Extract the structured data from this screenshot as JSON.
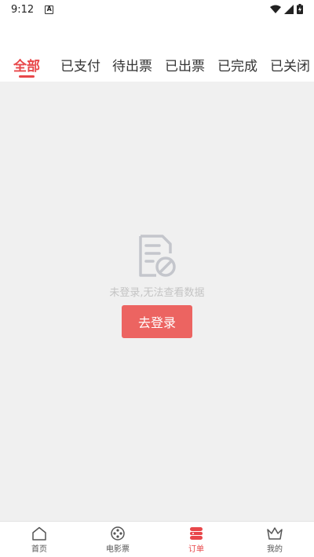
{
  "status_bar": {
    "time": "9:12",
    "notif_letter": "A"
  },
  "tabs": [
    {
      "label": "全部",
      "active": true
    },
    {
      "label": "已支付",
      "active": false
    },
    {
      "label": "待出票",
      "active": false
    },
    {
      "label": "已出票",
      "active": false
    },
    {
      "label": "已完成",
      "active": false
    },
    {
      "label": "已关闭",
      "active": false
    }
  ],
  "empty_state": {
    "message": "未登录,无法查看数据",
    "button_label": "去登录"
  },
  "bottom_nav": [
    {
      "label": "首页",
      "icon": "home-icon",
      "active": false
    },
    {
      "label": "电影票",
      "icon": "film-reel-icon",
      "active": false
    },
    {
      "label": "订单",
      "icon": "order-icon",
      "active": true
    },
    {
      "label": "我的",
      "icon": "crown-icon",
      "active": false
    }
  ],
  "colors": {
    "accent": "#e8474a",
    "button": "#ec6461",
    "background": "#f0f0f0"
  }
}
